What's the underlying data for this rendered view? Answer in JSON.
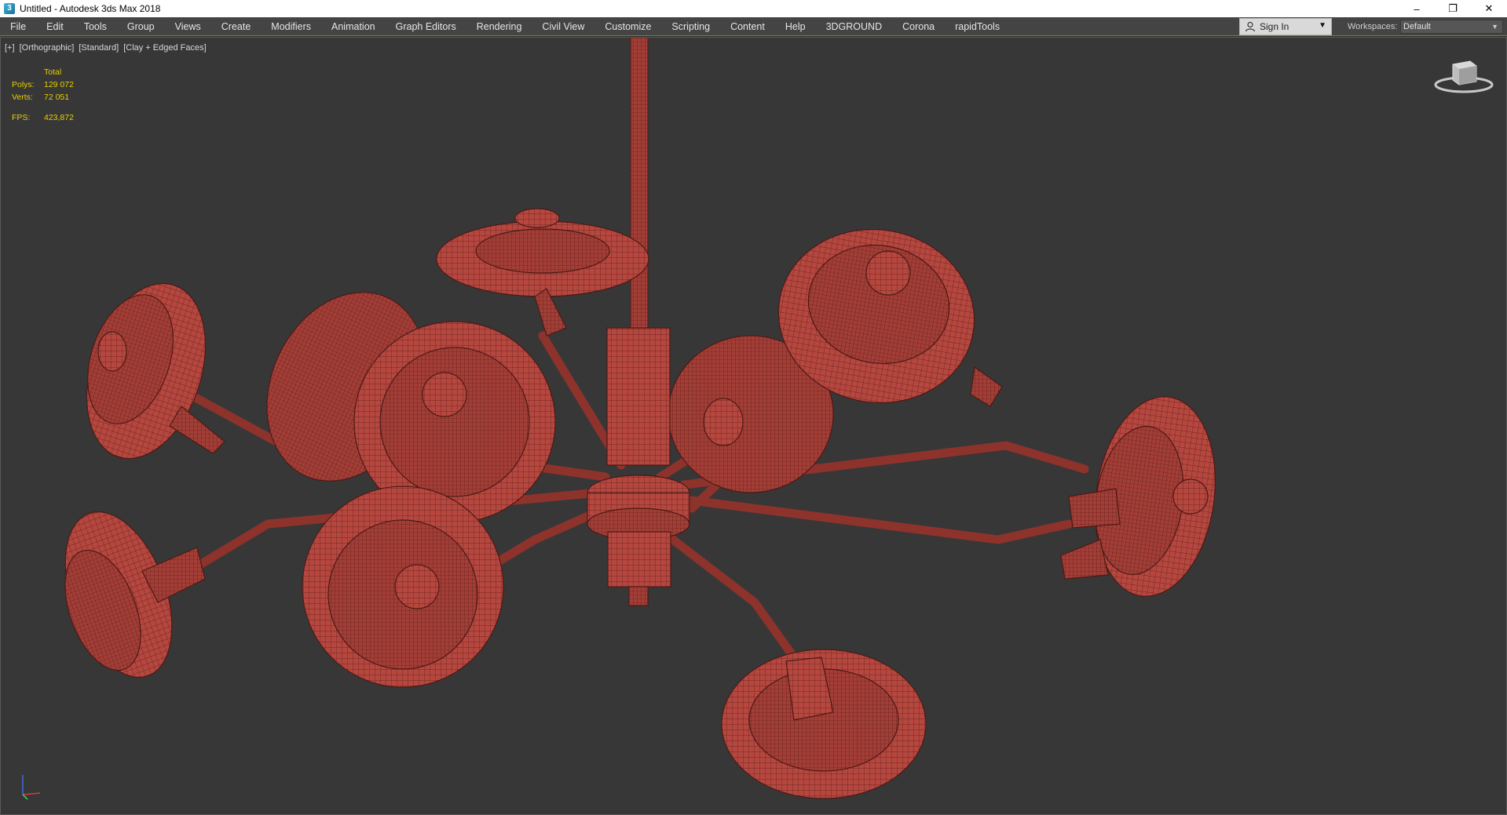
{
  "window": {
    "title": "Untitled - Autodesk 3ds Max 2018",
    "app_icon": "3",
    "controls": {
      "minimize": "–",
      "restore": "❐",
      "close": "✕"
    }
  },
  "menu": {
    "items": [
      "File",
      "Edit",
      "Tools",
      "Group",
      "Views",
      "Create",
      "Modifiers",
      "Animation",
      "Graph Editors",
      "Rendering",
      "Civil View",
      "Customize",
      "Scripting",
      "Content",
      "Help",
      "3DGROUND",
      "Corona",
      "rapidTools"
    ]
  },
  "account": {
    "sign_in_label": "Sign In"
  },
  "workspace": {
    "label": "Workspaces:",
    "value": "Default"
  },
  "viewport": {
    "labels": [
      "[+]",
      "[Orthographic]",
      "[Standard]",
      "[Clay + Edged Faces]"
    ],
    "stats": {
      "header": "Total",
      "polys_label": "Polys:",
      "polys_value": "129 072",
      "verts_label": "Verts:",
      "verts_value": "72 051",
      "fps_label": "FPS:",
      "fps_value": "423,872"
    },
    "model_color": "#b5473f",
    "background_color": "#373737",
    "stats_color": "#e8d000"
  }
}
